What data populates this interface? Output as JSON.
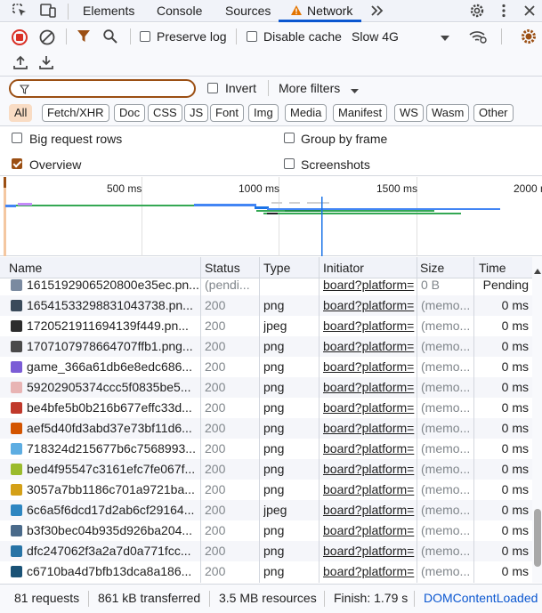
{
  "tabs": {
    "elements": "Elements",
    "console": "Console",
    "sources": "Sources",
    "network": "Network"
  },
  "toolbar": {
    "preserve_log": "Preserve log",
    "disable_cache": "Disable cache",
    "throttling": "Slow 4G",
    "preserve_log_checked": false,
    "disable_cache_checked": false
  },
  "filter": {
    "placeholder": "",
    "invert": "Invert",
    "more_filters": "More filters"
  },
  "type_filters": [
    "All",
    "Fetch/XHR",
    "Doc",
    "CSS",
    "JS",
    "Font",
    "Img",
    "Media",
    "Manifest",
    "WS",
    "Wasm",
    "Other"
  ],
  "active_type_filter": "All",
  "options": {
    "big_request_rows": "Big request rows",
    "group_by_frame": "Group by frame",
    "overview": "Overview",
    "screenshots": "Screenshots",
    "overview_checked": true
  },
  "overview": {
    "ticks": [
      "500 ms",
      "1000 ms",
      "1500 ms",
      "2000 ms"
    ]
  },
  "columns": {
    "name": "Name",
    "status": "Status",
    "type": "Type",
    "initiator": "Initiator",
    "size": "Size",
    "time": "Time"
  },
  "rows": [
    {
      "name": "1615192906520800e35ec.pn...",
      "status": "(pendi...",
      "type": "",
      "initiator": "board?platform=",
      "size": "0 B",
      "time": "Pending",
      "icon": "image-icon",
      "color": "#7a8aa0"
    },
    {
      "name": "1654153329883104373​8.pn...",
      "status": "200",
      "type": "png",
      "initiator": "board?platform=",
      "size": "(memo...",
      "time": "0 ms",
      "icon": "image-icon",
      "color": "#3a4a5a"
    },
    {
      "name": "1720521911694139f449.pn...",
      "status": "200",
      "type": "jpeg",
      "initiator": "board?platform=",
      "size": "(memo...",
      "time": "0 ms",
      "icon": "image-icon",
      "color": "#2d2d2d"
    },
    {
      "name": "1707107978664707ffb1.png...",
      "status": "200",
      "type": "png",
      "initiator": "board?platform=",
      "size": "(memo...",
      "time": "0 ms",
      "icon": "image-icon",
      "color": "#4a4a4a"
    },
    {
      "name": "game_366a61db6e8edc686...",
      "status": "200",
      "type": "png",
      "initiator": "board?platform=",
      "size": "(memo...",
      "time": "0 ms",
      "icon": "image-icon",
      "color": "#7b5cd6"
    },
    {
      "name": "59202905374ccc5f0835be5...",
      "status": "200",
      "type": "png",
      "initiator": "board?platform=",
      "size": "(memo...",
      "time": "0 ms",
      "icon": "image-icon",
      "color": "#e8b4b4"
    },
    {
      "name": "be4bfe5b0b216b677effc33d...",
      "status": "200",
      "type": "png",
      "initiator": "board?platform=",
      "size": "(memo...",
      "time": "0 ms",
      "icon": "image-icon",
      "color": "#c0392b"
    },
    {
      "name": "aef5d40fd3abd37e73bf11d6...",
      "status": "200",
      "type": "png",
      "initiator": "board?platform=",
      "size": "(memo...",
      "time": "0 ms",
      "icon": "image-icon",
      "color": "#d35400"
    },
    {
      "name": "718324d215677b6c7568993...",
      "status": "200",
      "type": "png",
      "initiator": "board?platform=",
      "size": "(memo...",
      "time": "0 ms",
      "icon": "image-icon",
      "color": "#5dade2"
    },
    {
      "name": "bed4f95547c3161efc7fe067f...",
      "status": "200",
      "type": "png",
      "initiator": "board?platform=",
      "size": "(memo...",
      "time": "0 ms",
      "icon": "image-icon",
      "color": "#9bbb2c"
    },
    {
      "name": "3057a7bb1186c701a9721ba...",
      "status": "200",
      "type": "png",
      "initiator": "board?platform=",
      "size": "(memo...",
      "time": "0 ms",
      "icon": "image-icon",
      "color": "#d4a017"
    },
    {
      "name": "6c6a5f6dcd17d2ab6cf29164...",
      "status": "200",
      "type": "jpeg",
      "initiator": "board?platform=",
      "size": "(memo...",
      "time": "0 ms",
      "icon": "image-icon",
      "color": "#2e86c1"
    },
    {
      "name": "b3f30bec04b935d926ba204...",
      "status": "200",
      "type": "png",
      "initiator": "board?platform=",
      "size": "(memo...",
      "time": "0 ms",
      "icon": "image-icon",
      "color": "#4a6a8a"
    },
    {
      "name": "dfc247062f3a2a7d0a771fcc...",
      "status": "200",
      "type": "png",
      "initiator": "board?platform=",
      "size": "(memo...",
      "time": "0 ms",
      "icon": "image-icon",
      "color": "#2874a6"
    },
    {
      "name": "c6710ba4d7bfb13dca8a186...",
      "status": "200",
      "type": "png",
      "initiator": "board?platform=",
      "size": "(memo...",
      "time": "0 ms",
      "icon": "image-icon",
      "color": "#1a5276"
    }
  ],
  "statusbar": {
    "requests": "81 requests",
    "transferred": "861 kB transferred",
    "resources": "3.5 MB resources",
    "finish": "Finish: 1.79 s",
    "dcl": "DOMContentLoaded"
  },
  "colors": {
    "accent": "#9b4f13",
    "active_tab": "#0b57d0",
    "record_red": "#d93025",
    "link_blue": "#0b57d0"
  }
}
